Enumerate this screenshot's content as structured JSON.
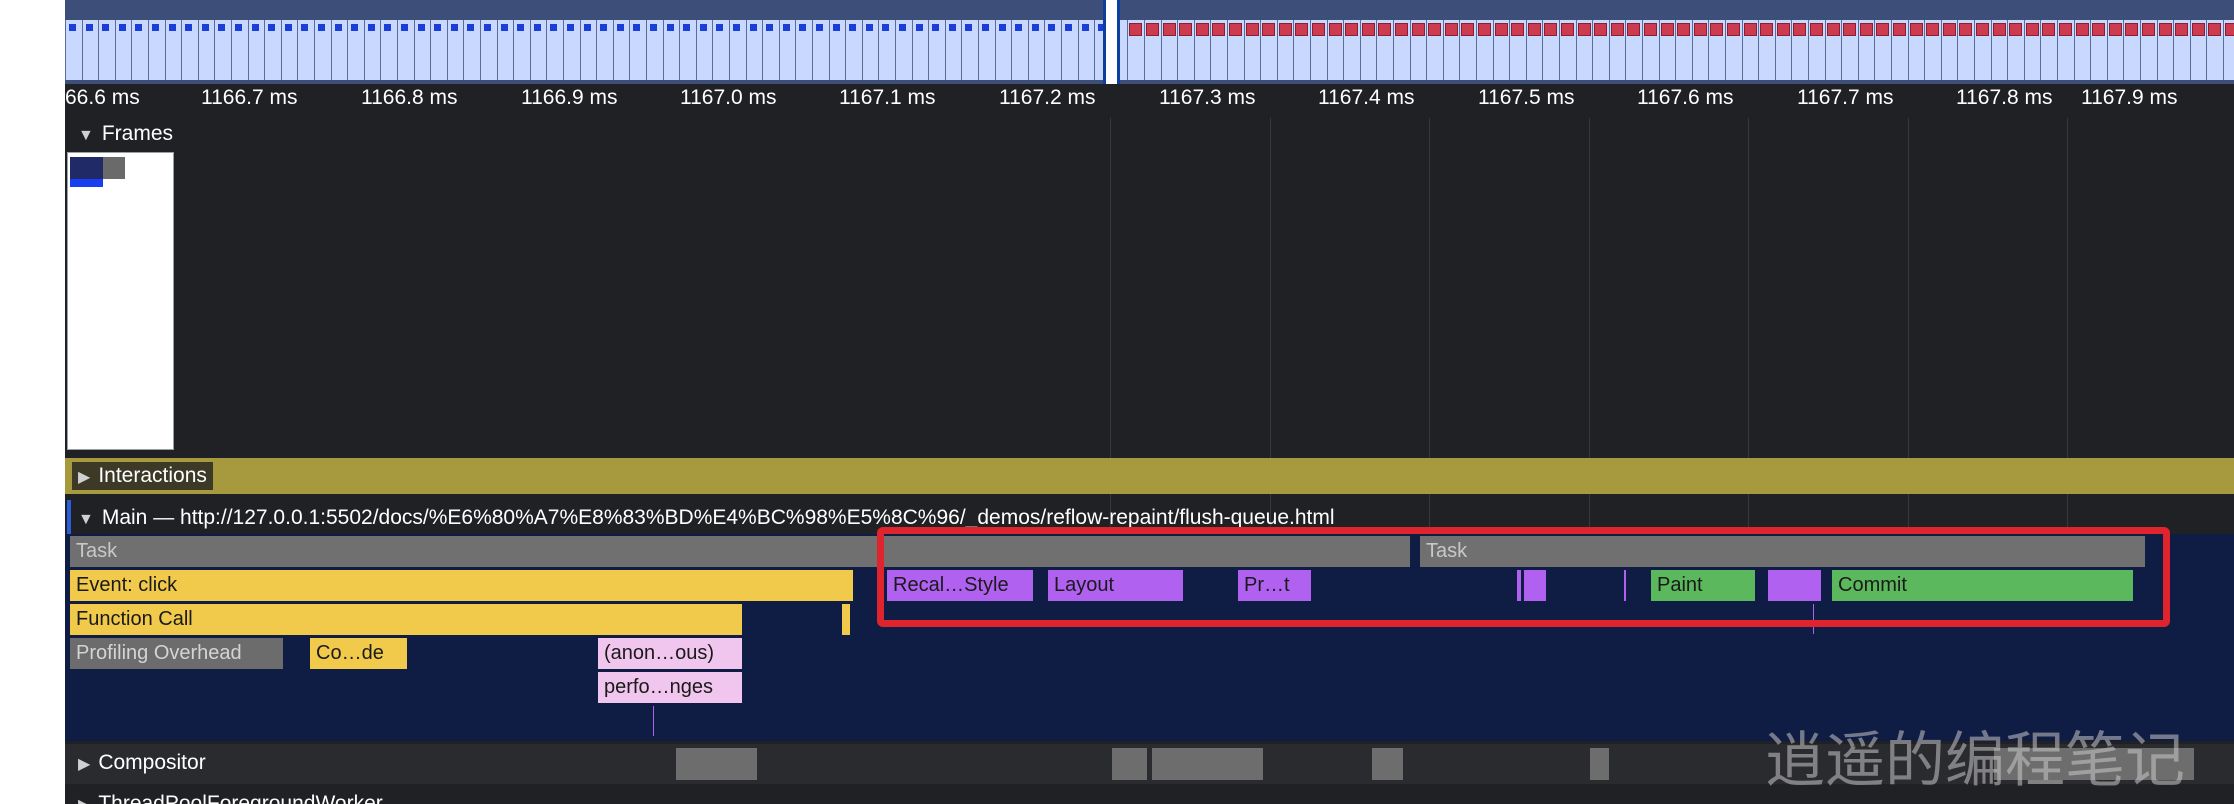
{
  "ruler": {
    "ticks": [
      "66.6 ms",
      "1166.7 ms",
      "1166.8 ms",
      "1166.9 ms",
      "1167.0 ms",
      "1167.1 ms",
      "1167.2 ms",
      "1167.3 ms",
      "1167.4 ms",
      "1167.5 ms",
      "1167.6 ms",
      "1167.7 ms",
      "1167.8 ms",
      "1167.9 ms"
    ]
  },
  "tracks": {
    "frames": {
      "label": "Frames"
    },
    "interactions": {
      "label": "Interactions"
    },
    "main": {
      "label": "Main — http://127.0.0.1:5502/docs/%E6%80%A7%E8%83%BD%E4%BC%98%E5%8C%96/_demos/reflow-repaint/flush-queue.html"
    },
    "compositor": {
      "label": "Compositor"
    },
    "thread_pool": {
      "label": "ThreadPoolForegroundWorker"
    }
  },
  "events": {
    "task1": "Task",
    "task2": "Task",
    "event_click": "Event: click",
    "function_call": "Function Call",
    "profiling_overhead": "Profiling Overhead",
    "compile_code": "Co…de",
    "anonymous": "(anon…ous)",
    "perform_changes": "perfo…nges",
    "recalc_style": "Recal…Style",
    "layout": "Layout",
    "pre_paint": "Pr…t",
    "paint": "Paint",
    "commit": "Commit"
  },
  "watermark": "逍遥的编程笔记",
  "colors": {
    "task": "#707070",
    "scripting": "#f2ca4b",
    "rendering": "#b061f0",
    "painting": "#5cb85c",
    "highlight": "#e0242e",
    "frames_strip": "#c9d8ff",
    "main_background": "#0f1c44"
  }
}
